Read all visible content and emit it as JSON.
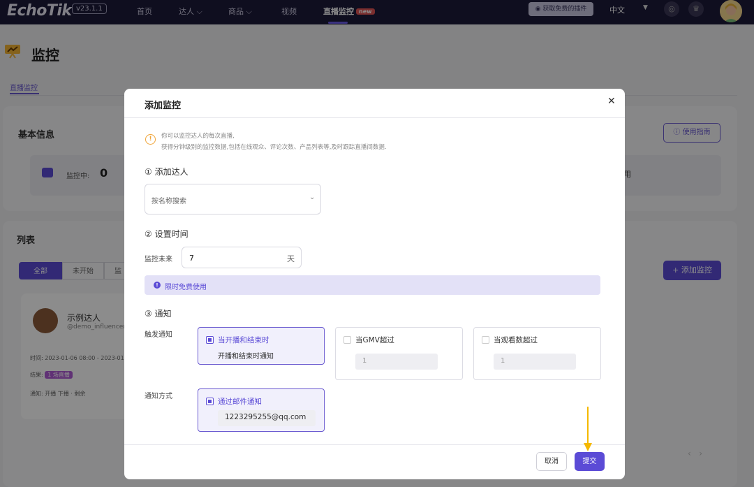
{
  "nav": {
    "logo": "EchoTik",
    "version": "v23.1.1",
    "items": [
      {
        "label": "首页"
      },
      {
        "label": "达人 ⌵"
      },
      {
        "label": "商品 ⌵"
      },
      {
        "label": "视频"
      },
      {
        "label": "直播监控",
        "badge": "new"
      }
    ],
    "plugin_label": "获取免费的插件",
    "lang": "中文",
    "accent": "#6c5ce7"
  },
  "page": {
    "title": "监控",
    "tab_live": "直播监控"
  },
  "info_card": {
    "title": "基本信息",
    "guide_label": "使用指南",
    "monitoring_label": "监控中:",
    "monitoring_count": "0",
    "right_partial": "用"
  },
  "list_card": {
    "title": "列表",
    "tabs": [
      "全部",
      "未开始",
      "监"
    ],
    "add_label": "添加监控",
    "sample": {
      "name": "示例达人",
      "handle": "@demo_influencer",
      "time": "时间: 2023-01-06 08:00 - 2023-01",
      "result_label": "结果:",
      "result_tag": "1 场直播",
      "notify": "通知: 开播  下播  ·  剩余"
    }
  },
  "modal": {
    "title": "添加监控",
    "info_line1": "你可以监控达人的每次直播,",
    "info_line2": "获得分钟级别的监控数据,包括在线观众、评论次数、产品列表等,及时跟踪直播间数据.",
    "step1": "① 添加达人",
    "search_placeholder": "按名称搜索",
    "step2": "② 设置时间",
    "monitor_future_label": "监控未来",
    "days_value": "7",
    "days_unit": "天",
    "free_notice": "限时免费使用",
    "step3": "③ 通知",
    "trigger_label": "触发通知",
    "opt1_label": "当开播和结束时",
    "opt1_sub": "开播和结束时通知",
    "opt2_label": "当GMV超过",
    "opt2_value": "1",
    "opt3_label": "当观看数超过",
    "opt3_value": "1",
    "method_label": "通知方式",
    "email_label": "通过邮件通知",
    "email_value": "1223295255@qq.com",
    "cancel_label": "取消",
    "submit_label": "提交"
  }
}
